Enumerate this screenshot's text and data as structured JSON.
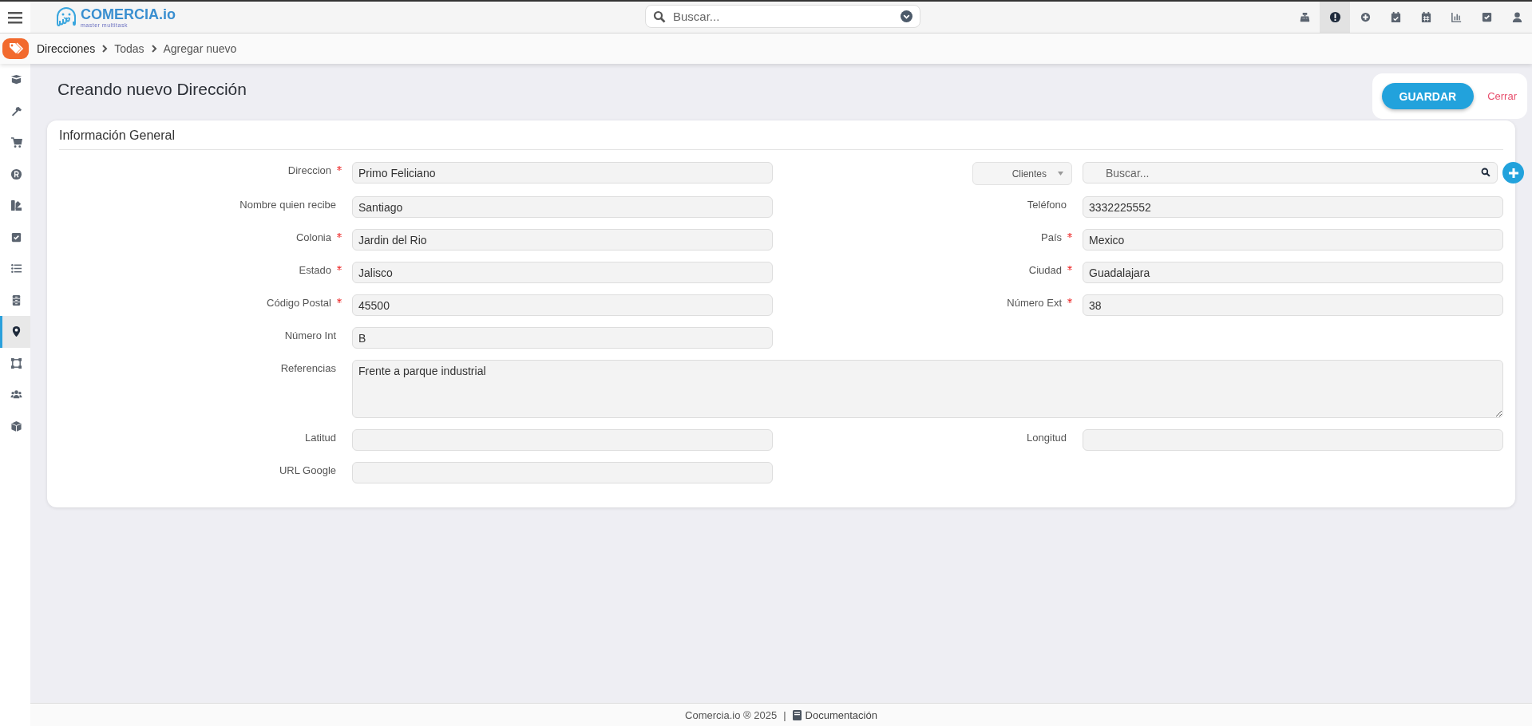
{
  "topbar": {
    "logo": {
      "name": "COMERCIA.io",
      "tagline": "master multitask"
    },
    "search": {
      "placeholder": "Buscar..."
    },
    "icons": [
      {
        "kind": "register",
        "selected": false
      },
      {
        "kind": "alert",
        "selected": true
      },
      {
        "kind": "plus",
        "selected": false
      },
      {
        "kind": "calendar-check",
        "selected": false
      },
      {
        "kind": "calendar",
        "selected": false
      },
      {
        "kind": "chart",
        "selected": false
      },
      {
        "kind": "check",
        "selected": false
      },
      {
        "kind": "user",
        "selected": false
      }
    ]
  },
  "breadcrumb": [
    "Direcciones",
    "Todas",
    "Agregar nuevo"
  ],
  "sidebar": {
    "items": [
      {
        "kind": "box",
        "selected": false
      },
      {
        "kind": "hammer",
        "selected": false
      },
      {
        "kind": "cart",
        "selected": false
      },
      {
        "kind": "registered",
        "selected": false
      },
      {
        "kind": "swatch",
        "selected": false
      },
      {
        "kind": "check",
        "selected": false
      },
      {
        "kind": "list",
        "selected": false
      },
      {
        "kind": "cabinet",
        "selected": false
      },
      {
        "kind": "pin",
        "selected": true
      },
      {
        "kind": "shape",
        "selected": false
      },
      {
        "kind": "users",
        "selected": false
      },
      {
        "kind": "cube",
        "selected": false
      }
    ]
  },
  "title": "Creando nuevo Dirección",
  "actions": {
    "save": "GUARDAR",
    "close": "Cerrar"
  },
  "card": {
    "title": "Información General",
    "rows": [
      {
        "fields": [
          {
            "kind": "text",
            "label": "Direccion",
            "required": true,
            "value": "Primo Feliciano"
          },
          {
            "kind": "picker",
            "select": "Clientes",
            "placeholder": "Buscar..."
          }
        ]
      },
      {
        "fields": [
          {
            "kind": "text",
            "label": "Nombre quien recibe",
            "required": false,
            "value": "Santiago"
          },
          {
            "kind": "text",
            "label": "Teléfono",
            "required": false,
            "value": "3332225552"
          }
        ]
      },
      {
        "fields": [
          {
            "kind": "text",
            "label": "Colonia",
            "required": true,
            "value": "Jardin del Rio"
          },
          {
            "kind": "text",
            "label": "País",
            "required": true,
            "value": "Mexico"
          }
        ]
      },
      {
        "fields": [
          {
            "kind": "text",
            "label": "Estado",
            "required": true,
            "value": "Jalisco"
          },
          {
            "kind": "text",
            "label": "Ciudad",
            "required": true,
            "value": "Guadalajara"
          }
        ]
      },
      {
        "fields": [
          {
            "kind": "text",
            "label": "Código Postal",
            "required": true,
            "value": "45500"
          },
          {
            "kind": "text",
            "label": "Número Ext",
            "required": true,
            "value": "38"
          }
        ]
      },
      {
        "fields": [
          {
            "kind": "text",
            "label": "Número Int",
            "required": false,
            "value": "B"
          }
        ]
      },
      {
        "fields": [
          {
            "kind": "textarea",
            "label": "Referencias",
            "required": false,
            "value": "Frente a parque industrial"
          }
        ]
      },
      {
        "fields": [
          {
            "kind": "text",
            "label": "Latitud",
            "required": false
          },
          {
            "kind": "text",
            "label": "Longitud",
            "required": false
          }
        ]
      },
      {
        "fields": [
          {
            "kind": "text",
            "label": "URL Google",
            "required": false
          }
        ]
      }
    ]
  },
  "footer": {
    "copyright": "Comercia.io ® 2025",
    "separator": "|",
    "link": "Documentación"
  }
}
